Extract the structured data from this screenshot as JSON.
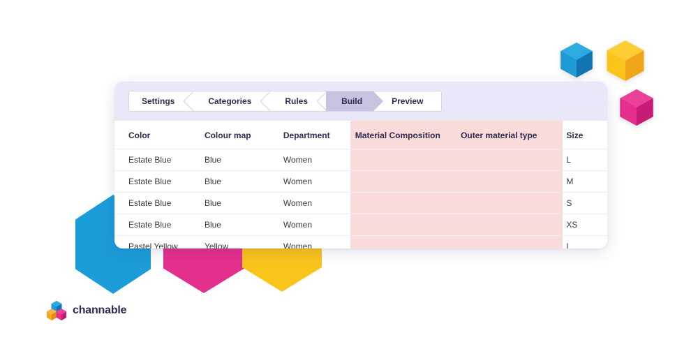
{
  "stepper": {
    "steps": [
      {
        "label": "Settings",
        "active": false
      },
      {
        "label": "Categories",
        "active": false
      },
      {
        "label": "Rules",
        "active": false
      },
      {
        "label": "Build",
        "active": true
      },
      {
        "label": "Preview",
        "active": false
      }
    ]
  },
  "table": {
    "columns": [
      {
        "key": "color",
        "label": "Color",
        "highlighted": false
      },
      {
        "key": "colour_map",
        "label": "Colour map",
        "highlighted": false
      },
      {
        "key": "department",
        "label": "Department",
        "highlighted": false
      },
      {
        "key": "material_composition",
        "label": "Material Composition",
        "highlighted": true
      },
      {
        "key": "outer_material_type",
        "label": "Outer material type",
        "highlighted": true
      },
      {
        "key": "size",
        "label": "Size",
        "highlighted": false
      }
    ],
    "rows": [
      {
        "color": "Estate Blue",
        "colour_map": "Blue",
        "department": "Women",
        "material_composition": "",
        "outer_material_type": "",
        "size": "L"
      },
      {
        "color": "Estate Blue",
        "colour_map": "Blue",
        "department": "Women",
        "material_composition": "",
        "outer_material_type": "",
        "size": "M"
      },
      {
        "color": "Estate Blue",
        "colour_map": "Blue",
        "department": "Women",
        "material_composition": "",
        "outer_material_type": "",
        "size": "S"
      },
      {
        "color": "Estate Blue",
        "colour_map": "Blue",
        "department": "Women",
        "material_composition": "",
        "outer_material_type": "",
        "size": "XS"
      },
      {
        "color": "Pastel Yellow",
        "colour_map": "Yellow",
        "department": "Women",
        "material_composition": "",
        "outer_material_type": "",
        "size": "L"
      }
    ]
  },
  "logo": {
    "wordmark": "channable",
    "mark_name": "channable-hexagon-logo",
    "colors": {
      "top_hex": "#1b9dd9",
      "left_hex": "#f5a623",
      "right_hex": "#e52f8d",
      "wordmark": "#2d2a4f"
    }
  },
  "decorations": {
    "cubes": [
      {
        "name": "blue-cube",
        "color": "#1b9dd9",
        "light": "#2ba8e0",
        "dark": "#1578b5"
      },
      {
        "name": "yellow-cube",
        "color": "#fbc41b",
        "light": "#fcc92e",
        "dark": "#f0a91a"
      },
      {
        "name": "pink-cube",
        "color": "#e52f8d",
        "light": "#ea3d97",
        "dark": "#cc1f78"
      }
    ],
    "flat_hexagons": [
      {
        "name": "blue-hexagon",
        "color": "#1b9dd9"
      },
      {
        "name": "pink-hexagon",
        "color": "#e52f8d"
      },
      {
        "name": "yellow-hexagon",
        "color": "#fbc41b"
      }
    ]
  },
  "theme": {
    "card_background": "#ffffff",
    "stepper_band": "#eae7f9",
    "active_step": "#c7c2e0",
    "highlight_column": "#f9dcd9",
    "header_text": "#2d2a4f",
    "body_text": "#3a3a46",
    "row_divider": "#efecf9"
  }
}
